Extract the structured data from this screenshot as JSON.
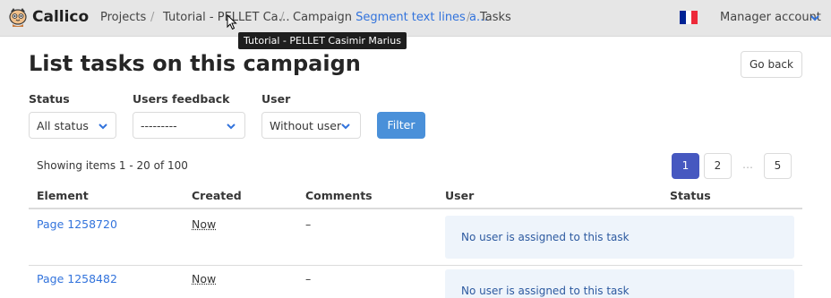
{
  "navbar": {
    "brand": "Callico",
    "breadcrumbs": {
      "projects": "Projects",
      "project": "Tutorial - PELLET Ca…",
      "campaign_prefix": "Campaign",
      "campaign_name": "Segment text lines a…",
      "current": "Tasks"
    },
    "account_label": "Manager account",
    "tooltip": "Tutorial - PELLET Casimir Marius",
    "language_flag": {
      "blue": "#002395",
      "white": "#ffffff",
      "red": "#ed2939"
    }
  },
  "page": {
    "title": "List tasks on this campaign",
    "go_back": "Go back"
  },
  "filters": {
    "status": {
      "label": "Status",
      "value": "All status"
    },
    "feedback": {
      "label": "Users feedback",
      "value": "---------"
    },
    "user": {
      "label": "User",
      "value": "Without user"
    },
    "submit": "Filter"
  },
  "pagination": {
    "summary": "Showing items 1 - 20 of 100",
    "pages": [
      "1",
      "2",
      "5"
    ],
    "current": "1",
    "ellipsis": "…"
  },
  "table": {
    "headers": [
      "Element",
      "Created",
      "Comments",
      "User",
      "Status"
    ],
    "rows": [
      {
        "element": "Page 1258720",
        "created": "Now",
        "comments": "–",
        "user": "No user is assigned to this task"
      },
      {
        "element": "Page 1258482",
        "created": "Now",
        "comments": "–",
        "user": "No user is assigned to this task"
      }
    ]
  },
  "colors": {
    "accent": "#3273dc",
    "filter_button": "#4a90d9",
    "current_page": "#4658c0",
    "notice_bg": "#eef4fb"
  }
}
